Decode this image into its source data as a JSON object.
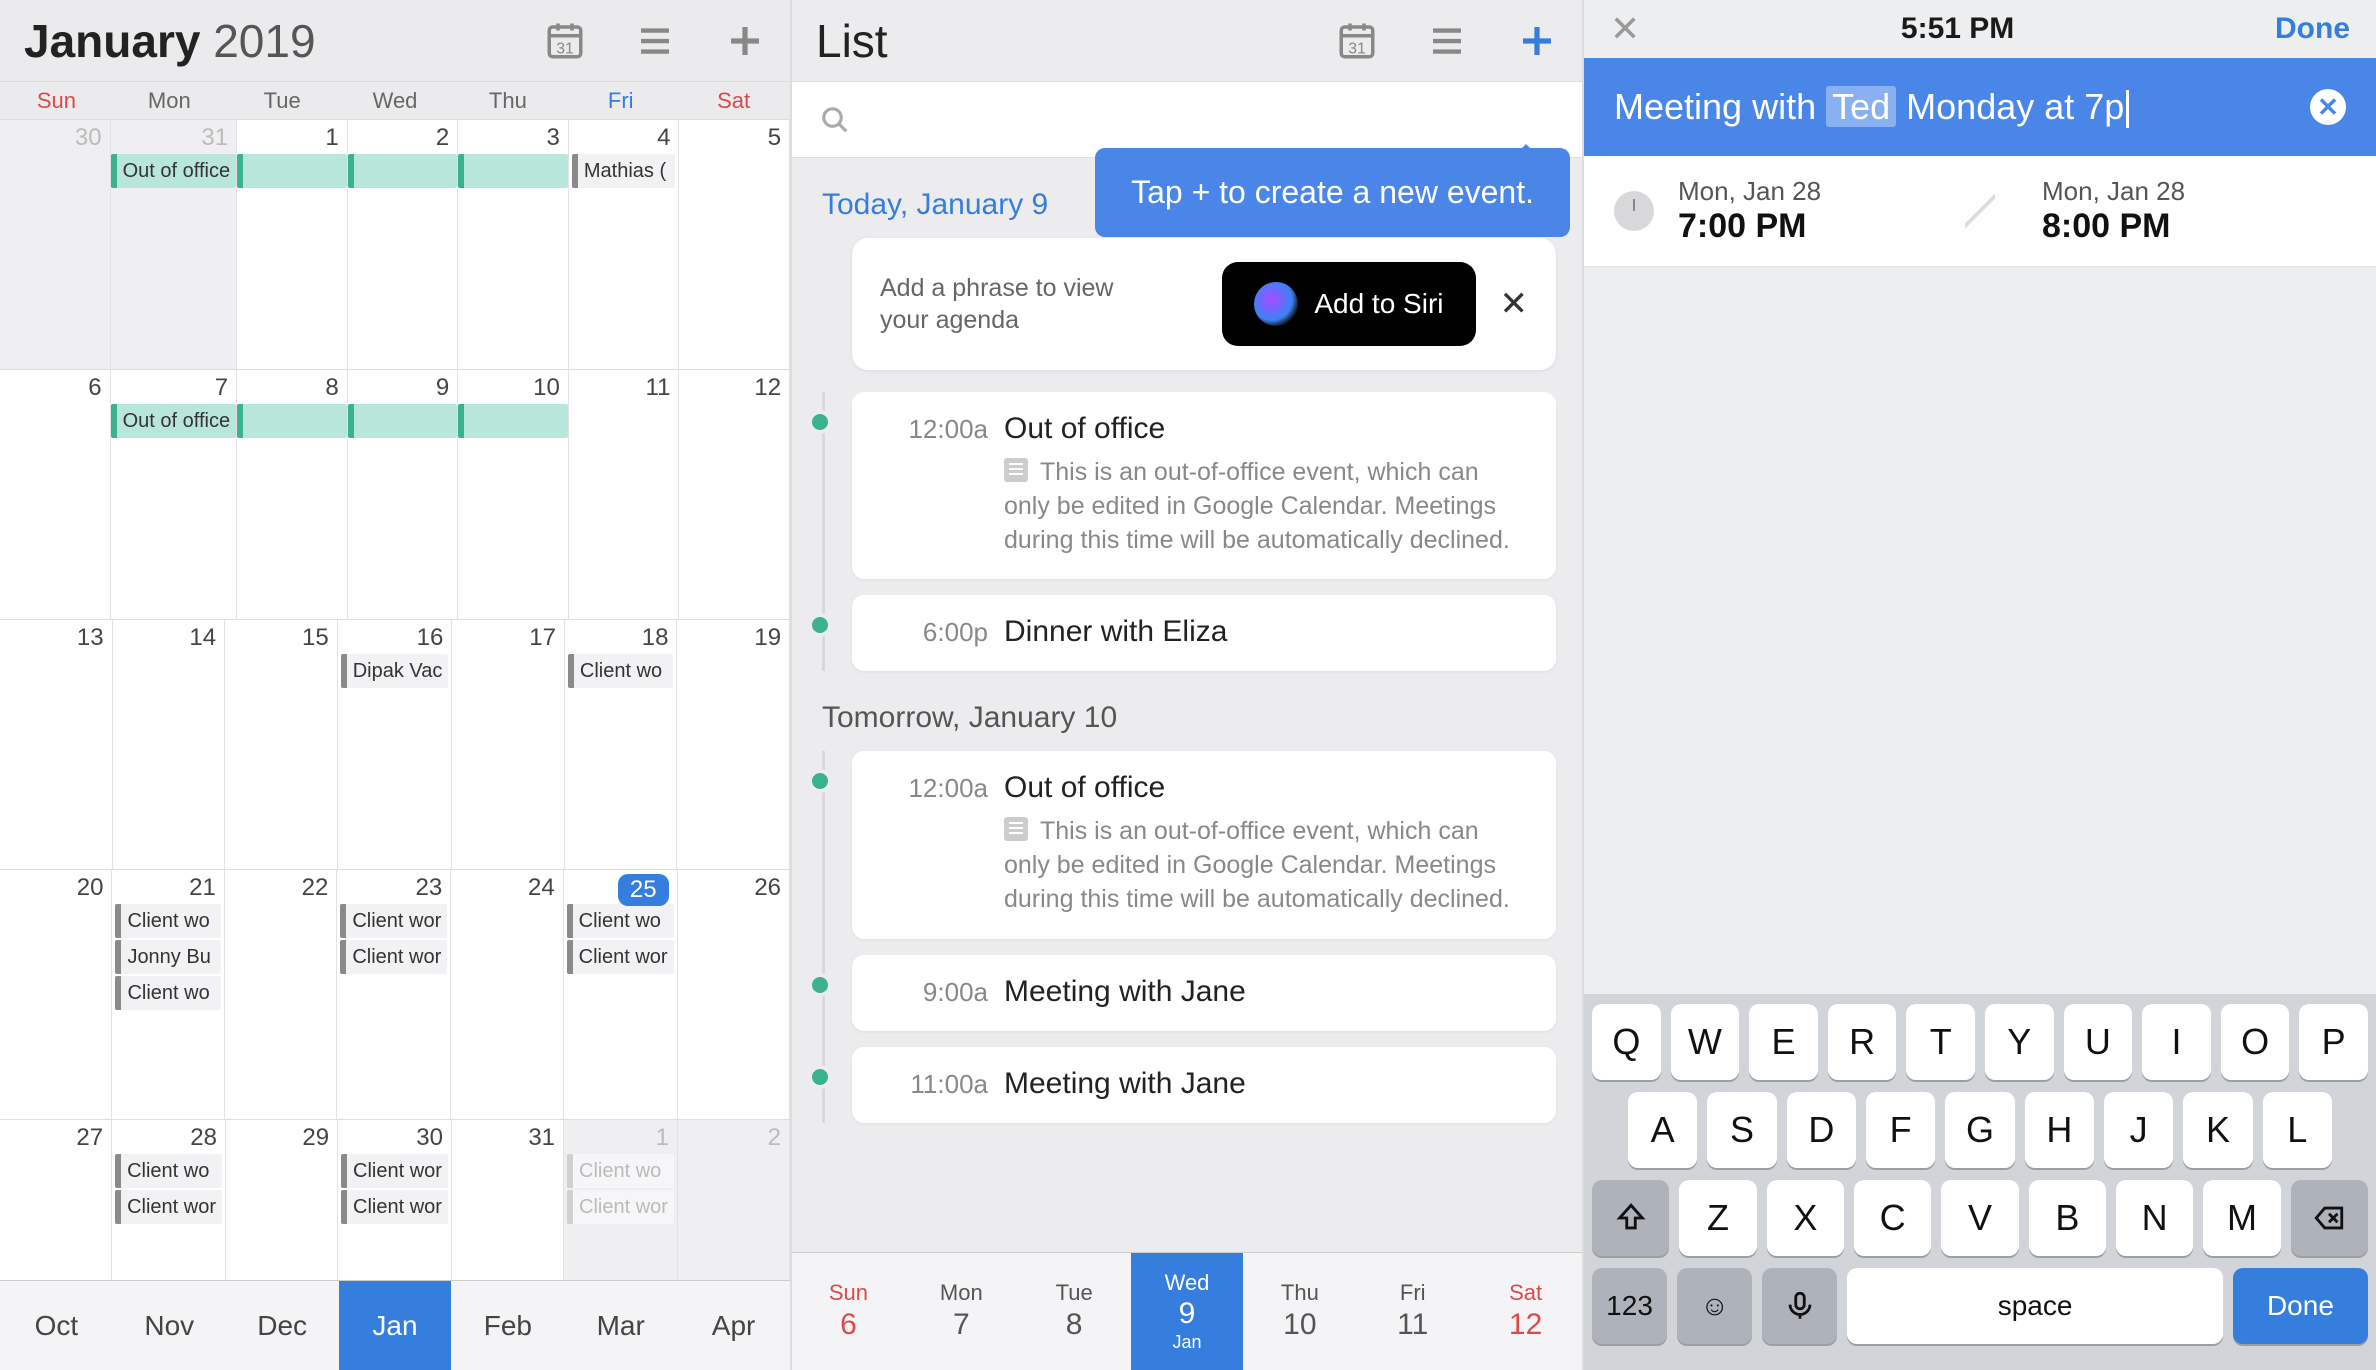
{
  "pane1": {
    "title_month": "January",
    "title_year": "2019",
    "dow": [
      "Sun",
      "Mon",
      "Tue",
      "Wed",
      "Thu",
      "Fri",
      "Sat"
    ],
    "weeks": [
      [
        {
          "n": "30",
          "grey": true
        },
        {
          "n": "31",
          "grey": true,
          "chips": [
            {
              "t": "Out of office",
              "c": "teal",
              "span": true
            }
          ]
        },
        {
          "n": "1",
          "chips": [
            {
              "t": "",
              "c": "teal",
              "span": true
            }
          ]
        },
        {
          "n": "2",
          "chips": [
            {
              "t": "",
              "c": "teal",
              "span": true
            }
          ]
        },
        {
          "n": "3",
          "chips": [
            {
              "t": "",
              "c": "teal",
              "span": true
            }
          ]
        },
        {
          "n": "4",
          "chips": [
            {
              "t": "Mathias (",
              "c": "line"
            }
          ]
        },
        {
          "n": "5"
        }
      ],
      [
        {
          "n": "6"
        },
        {
          "n": "7",
          "chips": [
            {
              "t": "Out of office",
              "c": "teal",
              "span": true
            }
          ]
        },
        {
          "n": "8",
          "chips": [
            {
              "t": "",
              "c": "teal",
              "span": true
            }
          ]
        },
        {
          "n": "9",
          "chips": [
            {
              "t": "",
              "c": "teal",
              "span": true
            }
          ]
        },
        {
          "n": "10",
          "chips": [
            {
              "t": "",
              "c": "teal",
              "span": true
            }
          ]
        },
        {
          "n": "11"
        },
        {
          "n": "12"
        }
      ],
      [
        {
          "n": "13"
        },
        {
          "n": "14"
        },
        {
          "n": "15"
        },
        {
          "n": "16",
          "chips": [
            {
              "t": "Dipak Vac",
              "c": "line"
            }
          ]
        },
        {
          "n": "17"
        },
        {
          "n": "18",
          "chips": [
            {
              "t": "Client wo",
              "c": "line"
            }
          ]
        },
        {
          "n": "19"
        }
      ],
      [
        {
          "n": "20"
        },
        {
          "n": "21",
          "chips": [
            {
              "t": "Client wo",
              "c": "line"
            },
            {
              "t": "Jonny Bu",
              "c": "line"
            },
            {
              "t": "Client wo",
              "c": "line"
            }
          ]
        },
        {
          "n": "22"
        },
        {
          "n": "23",
          "chips": [
            {
              "t": "Client wor",
              "c": "line"
            },
            {
              "t": "Client wor",
              "c": "line"
            }
          ]
        },
        {
          "n": "24"
        },
        {
          "n": "25",
          "sel": true,
          "chips": [
            {
              "t": "Client wo",
              "c": "line"
            },
            {
              "t": "Client wor",
              "c": "line"
            }
          ]
        },
        {
          "n": "26"
        }
      ],
      [
        {
          "n": "27"
        },
        {
          "n": "28",
          "chips": [
            {
              "t": "Client wo",
              "c": "line"
            },
            {
              "t": "Client wor",
              "c": "line"
            }
          ]
        },
        {
          "n": "29"
        },
        {
          "n": "30",
          "chips": [
            {
              "t": "Client wor",
              "c": "line"
            },
            {
              "t": "Client wor",
              "c": "line"
            }
          ]
        },
        {
          "n": "31"
        },
        {
          "n": "1",
          "grey": true,
          "chips": [
            {
              "t": "Client wo",
              "c": "ghost"
            },
            {
              "t": "Client wor",
              "c": "ghost"
            }
          ]
        },
        {
          "n": "2",
          "grey": true
        }
      ]
    ],
    "monthbar": [
      "Oct",
      "Nov",
      "Dec",
      "Jan",
      "Feb",
      "Mar",
      "Apr"
    ],
    "monthbar_sel": 3
  },
  "pane2": {
    "title": "List",
    "tooltip": "Tap + to create a new event.",
    "siri_text": "Add a phrase to view your agenda",
    "siri_btn": "Add to Siri",
    "sections": [
      {
        "header": "Today, January 9",
        "blue": true,
        "events": [
          {
            "time": "12:00a",
            "title": "Out of office",
            "desc": "This is an out-of-office event, which can only be edited in Google Calendar. Meetings during this time will be automatically declined."
          },
          {
            "time": "6:00p",
            "title": "Dinner with Eliza"
          }
        ]
      },
      {
        "header": "Tomorrow, January 10",
        "blue": false,
        "events": [
          {
            "time": "12:00a",
            "title": "Out of office",
            "desc": "This is an out-of-office event, which can only be edited in Google Calendar. Meetings during this time will be automatically declined."
          },
          {
            "time": "9:00a",
            "title": "Meeting with Jane"
          },
          {
            "time": "11:00a",
            "title": "Meeting with Jane"
          }
        ]
      }
    ],
    "weekbar": [
      {
        "w": "Sun",
        "d": "6",
        "cls": "sun"
      },
      {
        "w": "Mon",
        "d": "7"
      },
      {
        "w": "Tue",
        "d": "8"
      },
      {
        "w": "Wed",
        "d": "9",
        "m": "Jan",
        "sel": true
      },
      {
        "w": "Thu",
        "d": "10"
      },
      {
        "w": "Fri",
        "d": "11"
      },
      {
        "w": "Sat",
        "d": "12",
        "cls": "sat"
      }
    ]
  },
  "pane3": {
    "status_time": "5:51 PM",
    "status_done": "Done",
    "nlp_pre": "Meeting with ",
    "nlp_hl": "Ted",
    "nlp_post": " Monday at 7p",
    "start_date": "Mon, Jan 28",
    "start_time": "7:00 PM",
    "end_date": "Mon, Jan 28",
    "end_time": "8:00 PM",
    "kb": {
      "r1": [
        "Q",
        "W",
        "E",
        "R",
        "T",
        "Y",
        "U",
        "I",
        "O",
        "P"
      ],
      "r2": [
        "A",
        "S",
        "D",
        "F",
        "G",
        "H",
        "J",
        "K",
        "L"
      ],
      "r3": [
        "Z",
        "X",
        "C",
        "V",
        "B",
        "N",
        "M"
      ],
      "num": "123",
      "space": "space",
      "done": "Done"
    }
  }
}
